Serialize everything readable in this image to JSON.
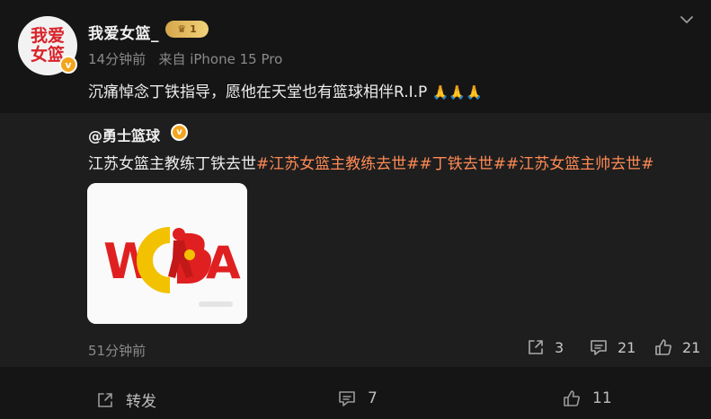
{
  "post": {
    "avatar_line1": "我爱",
    "avatar_line2": "女篮",
    "verified_mark": "v",
    "username": "我爱女篮_",
    "vip_level": "1",
    "time": "14分钟前",
    "source": "来自 iPhone 15 Pro",
    "text": "沉痛悼念丁铁指导，愿他在天堂也有篮球相伴R.I.P",
    "emoji": "🙏🙏🙏"
  },
  "repost": {
    "author": "@勇士篮球",
    "verified_mark": "v",
    "text_plain": "江苏女篮主教练丁铁去世",
    "hashtags": [
      "#江苏女篮主教练去世#",
      "#丁铁去世#",
      "#江苏女篮主帅去世#"
    ],
    "image": {
      "logo_text_left": "W",
      "logo_text_right": "A",
      "brand_colors": [
        "#e02020",
        "#f2c200"
      ]
    },
    "time": "51分钟前",
    "stats": {
      "reposts": "3",
      "comments": "21",
      "likes": "21"
    }
  },
  "actions": {
    "repost_label": "转发",
    "comments": "7",
    "likes": "11"
  },
  "icons": {
    "chevron": "chevron-down-icon",
    "share": "share-icon",
    "comment": "comment-icon",
    "like": "thumbs-up-icon"
  },
  "colors": {
    "hashtag": "#ff8a55",
    "verify": "#f2a51e",
    "background": "#151515",
    "repost_bg": "#1e1e1e"
  }
}
